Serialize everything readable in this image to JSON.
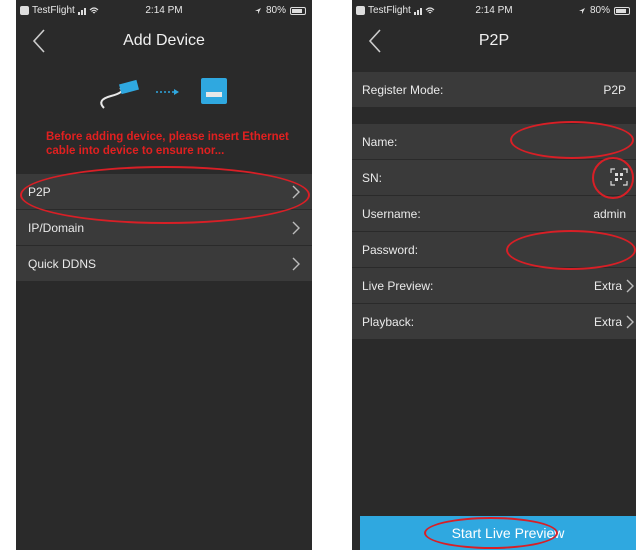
{
  "status": {
    "carrier": "TestFlight",
    "time": "2:14 PM",
    "battery": "80%"
  },
  "left": {
    "title": "Add Device",
    "warning": "Before adding device, please insert Ethernet cable into device to ensure nor...",
    "items": [
      {
        "label": "P2P"
      },
      {
        "label": "IP/Domain"
      },
      {
        "label": "Quick DDNS"
      }
    ]
  },
  "right": {
    "title": "P2P",
    "register_mode_label": "Register Mode:",
    "register_mode_value": "P2P",
    "fields": [
      {
        "label": "Name:",
        "value": ""
      },
      {
        "label": "SN:",
        "value": ""
      },
      {
        "label": "Username:",
        "value": "admin"
      },
      {
        "label": "Password:",
        "value": ""
      },
      {
        "label": "Live Preview:",
        "value": "Extra"
      },
      {
        "label": "Playback:",
        "value": "Extra"
      }
    ],
    "button": "Start Live Preview"
  },
  "colors": {
    "background": "#2a2a2a",
    "row": "#3a3a3a",
    "accent": "#2fa8e0",
    "warning": "#e02020",
    "annotation": "#d81f26"
  }
}
